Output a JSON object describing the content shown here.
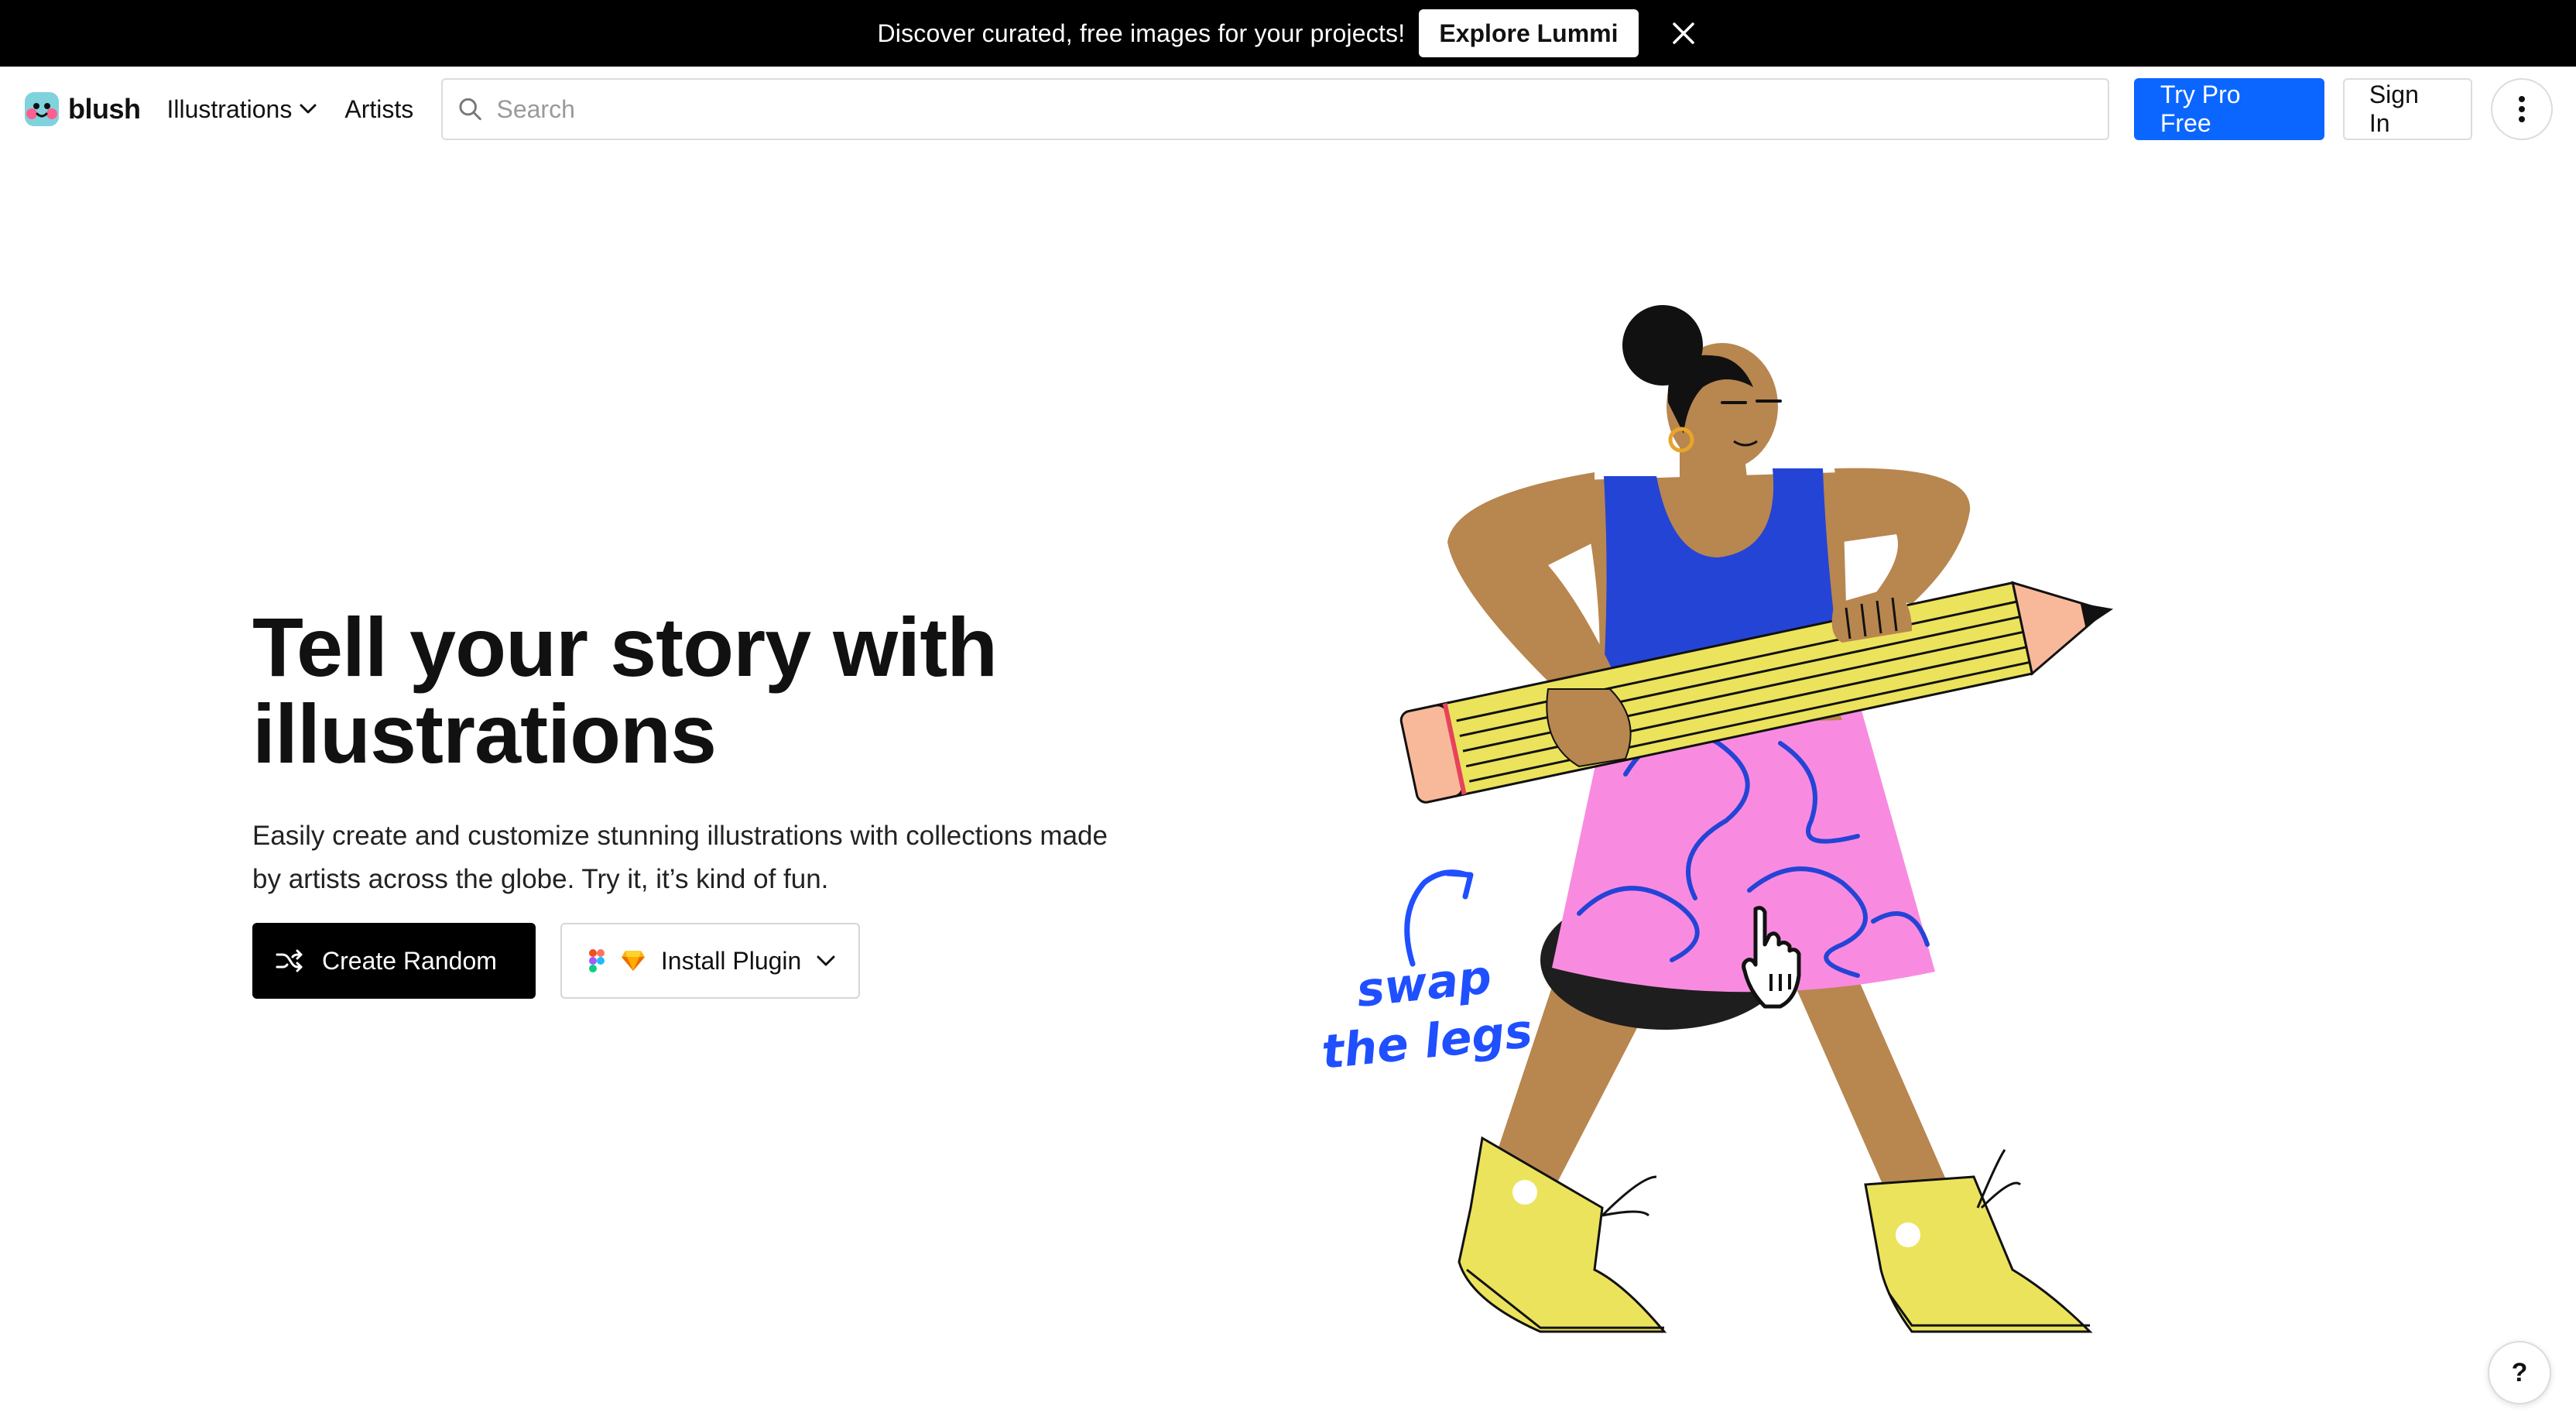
{
  "banner": {
    "text": "Discover curated, free images for your projects!",
    "button": "Explore Lummi"
  },
  "header": {
    "logo_text": "blush",
    "nav": [
      {
        "label": "Illustrations"
      },
      {
        "label": "Artists"
      }
    ],
    "search_placeholder": "Search",
    "search_value": "",
    "try_pro": "Try Pro Free",
    "sign_in": "Sign In"
  },
  "hero": {
    "title": "Tell your story with illustrations",
    "subtitle": "Easily create and customize stunning illustrations with collections made by artists across the globe. Try it, it’s kind of fun.",
    "create_random": "Create Random",
    "install_plugin": "Install Plugin",
    "annotation_line1": "swap",
    "annotation_line2": "the legs"
  },
  "help": {
    "label": "?"
  },
  "colors": {
    "accent": "#0a66ff",
    "banner_bg": "#000000",
    "annotation": "#1f4fff",
    "dress_pink": "#f88be0",
    "top_blue": "#2444d6",
    "pencil_yellow": "#ece35c",
    "skin": "#b8864f"
  }
}
